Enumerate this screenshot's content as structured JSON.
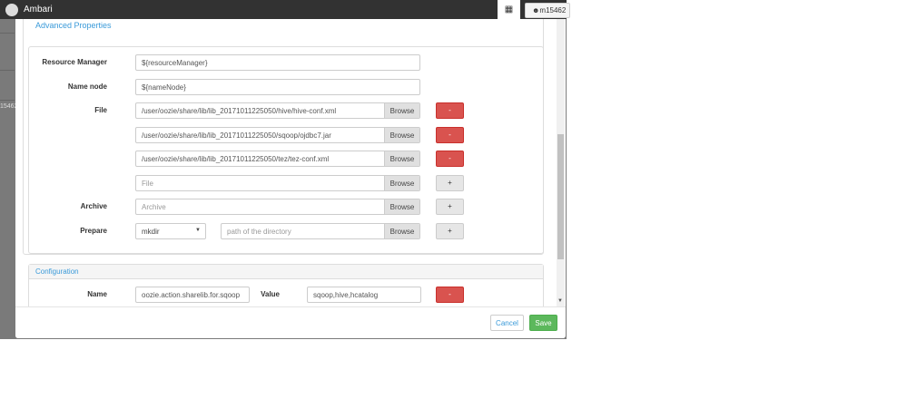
{
  "header": {
    "brand": "Ambari",
    "user": "m15462"
  },
  "sidebar": {
    "user_id": "15462"
  },
  "modal": {
    "section_title": "Advanced Properties",
    "resource_manager": {
      "label": "Resource Manager",
      "value": "${resourceManager}"
    },
    "name_node": {
      "label": "Name node",
      "value": "${nameNode}"
    },
    "file": {
      "label": "File",
      "values": [
        "/user/oozie/share/lib/lib_20171011225050/hive/hive-conf.xml",
        "/user/oozie/share/lib/lib_20171011225050/sqoop/ojdbc7.jar",
        "/user/oozie/share/lib/lib_20171011225050/tez/tez-conf.xml"
      ],
      "placeholder": "File"
    },
    "archive": {
      "label": "Archive",
      "placeholder": "Archive"
    },
    "prepare": {
      "label": "Prepare",
      "selected": "mkdir",
      "placeholder": "path of the directory"
    },
    "browse": "Browse",
    "remove": "-",
    "add": "+",
    "configuration": {
      "title": "Configuration",
      "name_label": "Name",
      "name_value": "oozie.action.sharelib.for.sqoop",
      "value_label": "Value",
      "value_value": "sqoop,hive,hcatalog"
    },
    "cancel": "Cancel",
    "save": "Save"
  }
}
